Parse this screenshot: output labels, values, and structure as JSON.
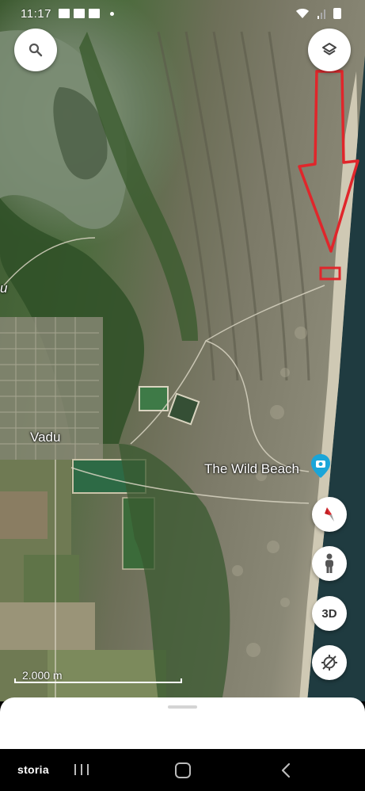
{
  "status_bar": {
    "time": "11:17",
    "notification_icons": [
      "gallery-icon",
      "news-icon",
      "mail-icon",
      "dot-icon"
    ],
    "right_icons": [
      "wifi-icon",
      "signal-icon",
      "battery-icon"
    ]
  },
  "map": {
    "places": {
      "vadu": "Vadu",
      "wild_beach": "The Wild Beach",
      "partial_left": "u"
    },
    "scale_label": "2.000 m",
    "annotation": {
      "shape": "red-arrow-and-box",
      "color": "#e0262b"
    }
  },
  "controls": {
    "search_icon": "search-icon",
    "layers_icon": "layers-icon",
    "compass_icon": "compass-icon",
    "pegman_icon": "street-view-icon",
    "label_3d": "3D",
    "location_icon": "my-location-icon"
  },
  "nav_bar": {
    "brand": "storia",
    "icons": [
      "recents-icon",
      "home-icon",
      "back-icon"
    ]
  },
  "colors": {
    "annotation_red": "#e0262b",
    "pin_blue": "#1aa5d8",
    "sea": "#1e3a3f"
  }
}
